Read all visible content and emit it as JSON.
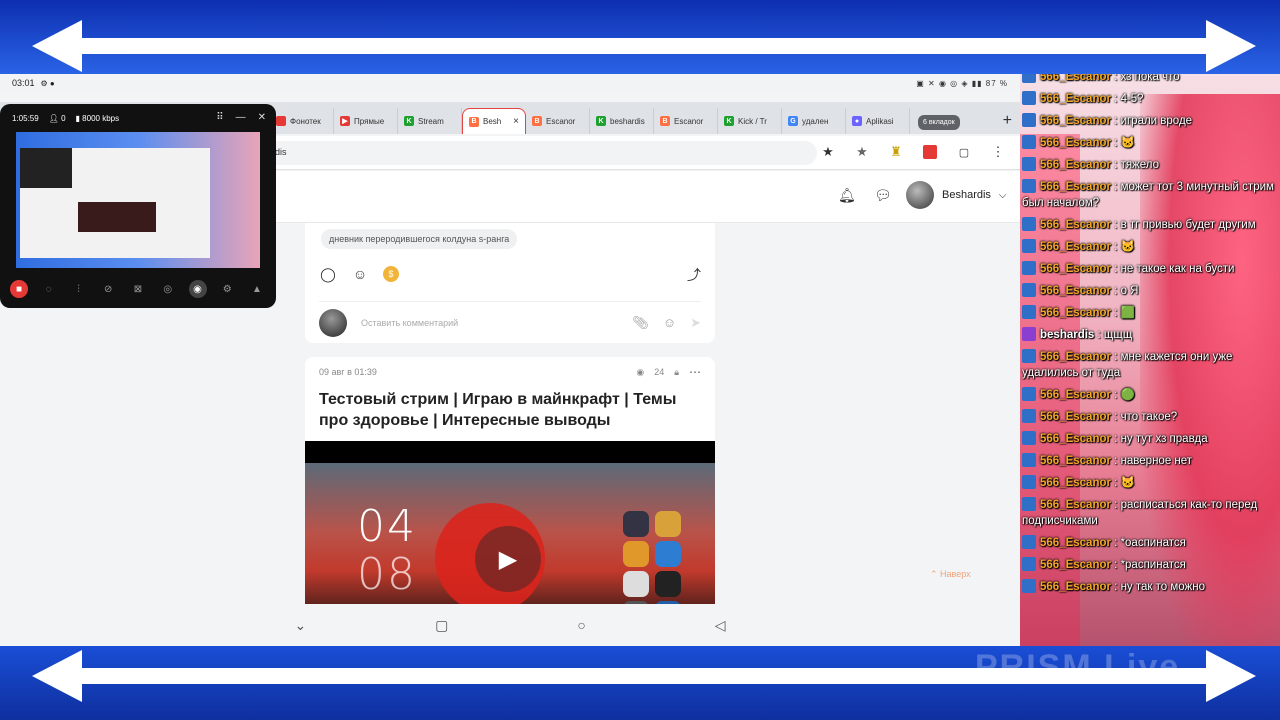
{
  "status": {
    "time": "03:01",
    "battery": "87 %"
  },
  "tabs": [
    {
      "label": "Фонотек",
      "color": "#e53935",
      "glyph": ""
    },
    {
      "label": "Прямые",
      "color": "#e53935",
      "glyph": "▶"
    },
    {
      "label": "Stream",
      "color": "#1fa12f",
      "glyph": "K"
    },
    {
      "label": "Besh",
      "color": "#ff7043",
      "glyph": "B",
      "active": true
    },
    {
      "label": "Escanor",
      "color": "#ff7043",
      "glyph": "B"
    },
    {
      "label": "beshardis",
      "color": "#1fa12f",
      "glyph": "K"
    },
    {
      "label": "Escanor",
      "color": "#ff7043",
      "glyph": "B"
    },
    {
      "label": "Kick / Tr",
      "color": "#1fa12f",
      "glyph": "K"
    },
    {
      "label": "удален",
      "color": "#4285f4",
      "glyph": "G"
    },
    {
      "label": "Aplikasi",
      "color": "#6c63ff",
      "glyph": "●"
    }
  ],
  "tab_count": "6 вкладок",
  "url": "rdis",
  "user": {
    "name": "Beshardis"
  },
  "post1": {
    "tag": "дневник переродившегося колдуна s-ранга",
    "comment_placeholder": "Оставить комментарий"
  },
  "post2": {
    "date": "09 авг в 01:39",
    "views": "24",
    "title": "Тестовый стрим | Играю в майнкрафт | Темы про здоровье | Интересные выводы",
    "clock_h": "04",
    "clock_m": "08"
  },
  "scroll_top": "Наверх",
  "recorder": {
    "duration": "1:05:59",
    "viewers": "0",
    "bitrate": "8000 kbps"
  },
  "chat": [
    {
      "user": "566_Escanor",
      "text": "хз пока что"
    },
    {
      "user": "566_Escanor",
      "text": "4-5?"
    },
    {
      "user": "566_Escanor",
      "text": "играли вроде"
    },
    {
      "user": "566_Escanor",
      "text": "🐱"
    },
    {
      "user": "566_Escanor",
      "text": "тяжело"
    },
    {
      "user": "566_Escanor",
      "text": "может тот 3 минутный стрим был началом?"
    },
    {
      "user": "566_Escanor",
      "text": "в тг привью будет другим"
    },
    {
      "user": "566_Escanor",
      "text": "🐱"
    },
    {
      "user": "566_Escanor",
      "text": "не такое как на бусти"
    },
    {
      "user": "566_Escanor",
      "text": "о Я"
    },
    {
      "user": "566_Escanor",
      "text": "🟩"
    },
    {
      "user": "beshardis",
      "text": "щщщ",
      "host": true
    },
    {
      "user": "566_Escanor",
      "text": "мне кажется они уже удалились от туда"
    },
    {
      "user": "566_Escanor",
      "text": "🟢"
    },
    {
      "user": "566_Escanor",
      "text": "что такое?"
    },
    {
      "user": "566_Escanor",
      "text": "ну тут хз правда"
    },
    {
      "user": "566_Escanor",
      "text": "наверное нет"
    },
    {
      "user": "566_Escanor",
      "text": "🐱"
    },
    {
      "user": "566_Escanor",
      "text": "расписаться как-то перед подписчиками"
    },
    {
      "user": "566_Escanor",
      "text": "*оаспинатся"
    },
    {
      "user": "566_Escanor",
      "text": "*распинатся"
    },
    {
      "user": "566_Escanor",
      "text": "ну так то можно"
    }
  ],
  "watermark": "PRISM Live"
}
